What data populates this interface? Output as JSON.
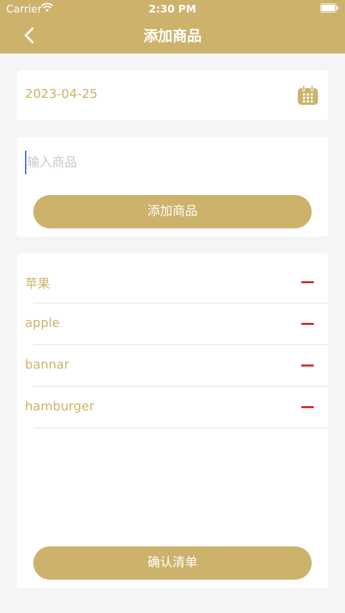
{
  "status_bar": {
    "carrier": "Carrier",
    "time": "2:30 PM"
  },
  "nav": {
    "title": "添加商品",
    "back_icon": "chevron-left-icon"
  },
  "date_card": {
    "date": "2023-04-25",
    "icon": "calendar-icon"
  },
  "input_card": {
    "placeholder": "输入商品",
    "value": "",
    "add_button_label": "添加商品"
  },
  "goods_list": {
    "items": [
      {
        "label": "苹果"
      },
      {
        "label": "apple"
      },
      {
        "label": "bannar"
      },
      {
        "label": "hamburger"
      }
    ],
    "remove_icon": "minus-icon"
  },
  "confirm_button_label": "确认清单",
  "colors": {
    "accent": "#cdb26b",
    "remove": "#c9342a",
    "background": "#f5f5f5",
    "cursor": "#3b6cf0"
  }
}
